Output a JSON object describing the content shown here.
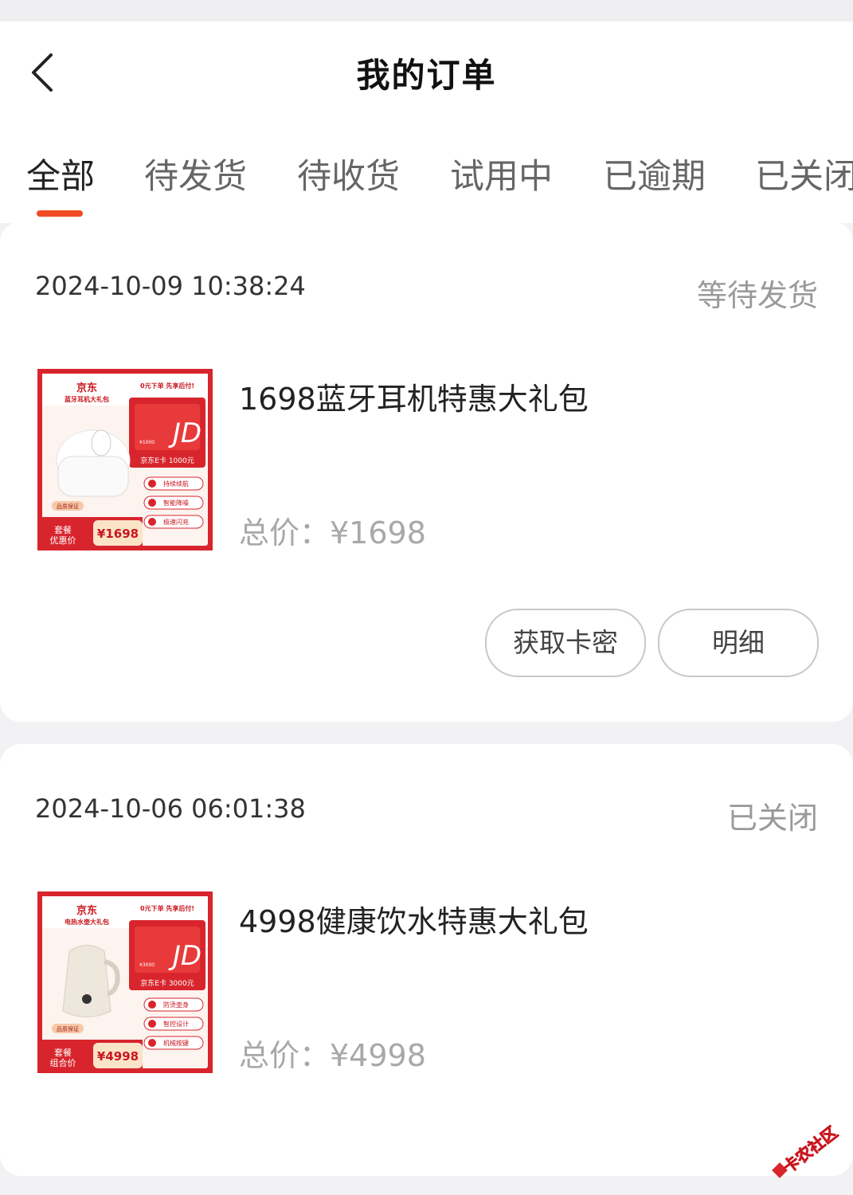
{
  "header": {
    "title": "我的订单"
  },
  "tabs": [
    "全部",
    "待发货",
    "待收货",
    "试用中",
    "已逾期",
    "已关闭"
  ],
  "orders": [
    {
      "time": "2024-10-09 10:38:24",
      "status": "等待发货",
      "product_name": "1698蓝牙耳机特惠大礼包",
      "price": "总价：¥1698",
      "buttons": [
        "获取卡密",
        "明细"
      ],
      "thumb": {
        "brand": "京东",
        "sub": "蓝牙耳机大礼包",
        "slogan": "0元下单 先享后付!",
        "card_label": "京东E卡 1000元",
        "card_value": "¥1000",
        "features": [
          "持续续航",
          "智能降噪",
          "极速闪充"
        ],
        "badge": "品质保证",
        "deal": "套餐\n优惠价",
        "deal_price": "¥1698"
      }
    },
    {
      "time": "2024-10-06 06:01:38",
      "status": "已关闭",
      "product_name": "4998健康饮水特惠大礼包",
      "price": "总价：¥4998",
      "buttons": [],
      "thumb": {
        "brand": "京东",
        "sub": "电热水壶大礼包",
        "slogan": "0元下单 先享后付!",
        "card_label": "京东E卡 3000元",
        "card_value": "¥3000",
        "features": [
          "防烫壶身",
          "智控设计",
          "机械按键"
        ],
        "badge": "品质保证",
        "deal": "套餐\n组合价",
        "deal_price": "¥4998"
      }
    }
  ],
  "watermark": "卡农社区",
  "colors": {
    "accent": "#f04b22",
    "thumb_red": "#d8252d"
  },
  "icons": {
    "back": "chevron-left-icon"
  }
}
